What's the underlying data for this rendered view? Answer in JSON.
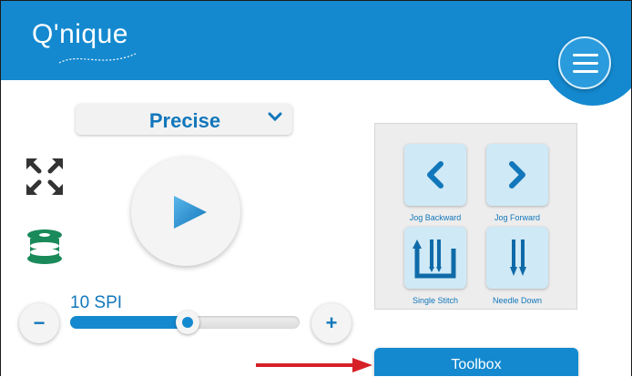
{
  "header": {
    "logo_text": "Q'nique",
    "menu_icon": "hamburger-menu-icon"
  },
  "mode": {
    "selected": "Precise",
    "chevron_icon": "chevron-down-icon"
  },
  "side_icons": {
    "expand": "expand-arrows-icon",
    "spool": "bobbin-spool-icon"
  },
  "play": {
    "icon": "play-icon"
  },
  "stitch": {
    "label": "10 SPI",
    "level_percent": 51,
    "minus": "−",
    "plus": "+"
  },
  "jog": {
    "buttons": [
      {
        "label": "Jog Backward",
        "icon": "chevron-left-icon"
      },
      {
        "label": "Jog Forward",
        "icon": "chevron-right-icon"
      },
      {
        "label": "Single Stitch",
        "icon": "single-stitch-icon"
      },
      {
        "label": "Needle Down",
        "icon": "needle-down-icon"
      }
    ]
  },
  "toolbox": {
    "label": "Toolbox"
  },
  "colors": {
    "brand_blue": "#1489cf",
    "text_blue": "#1277bb",
    "green": "#1a8a5a",
    "arrow_red": "#d62027"
  }
}
